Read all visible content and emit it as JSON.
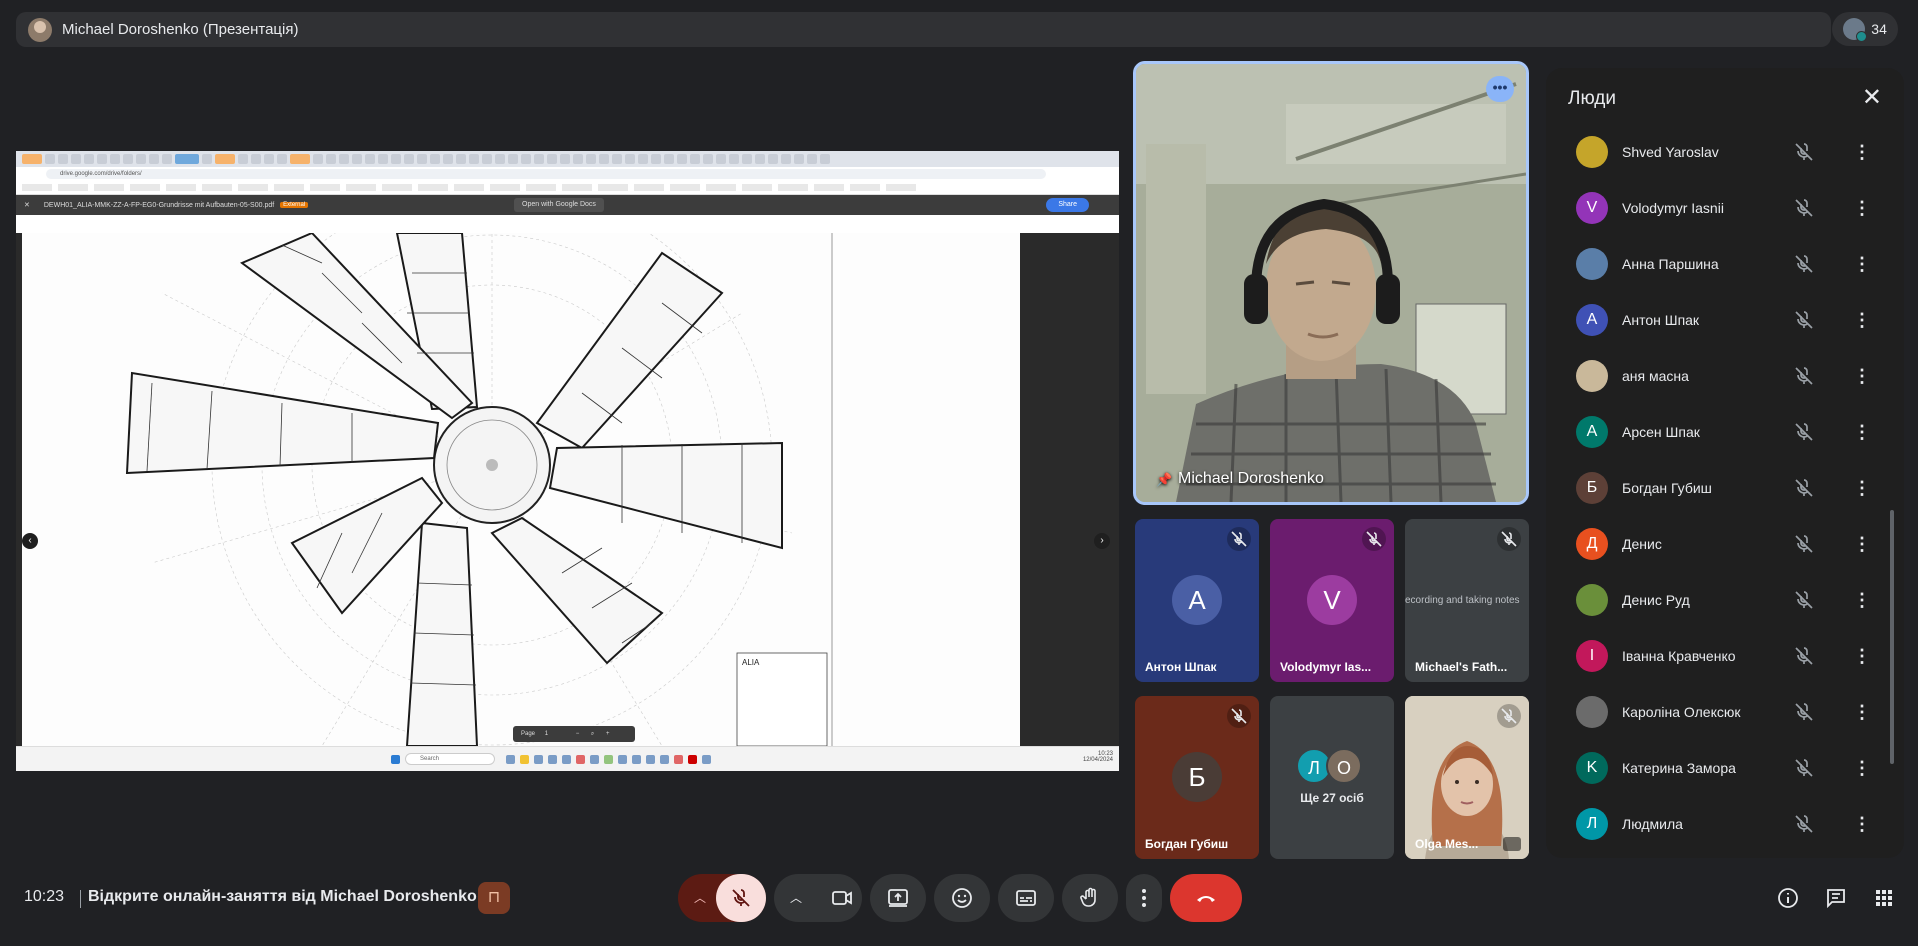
{
  "meeting": {
    "presenter_title": "Michael Doroshenko (Презентація)",
    "participants_count": "34",
    "time": "10:23",
    "title": "Відкрите онлайн-заняття від Michael Doroshenko"
  },
  "presentation": {
    "filename": "DEWH01_ALIA-MMK-ZZ-A-FP-EG0-Grundrisse mit Aufbauten-05-S00.pdf",
    "external_tag": "External",
    "open_with": "Open with Google Docs",
    "share_label": "Share",
    "page_label": "Page",
    "page_number": "1",
    "address": "drive.google.com/drive/folders/",
    "taskbar_search": "Search",
    "taskbar_time": "10:23",
    "taskbar_date": "12/04/2024",
    "title_block": "ALIA"
  },
  "speaker": {
    "name": "Michael Doroshenko",
    "more_label": "•••"
  },
  "tiles": [
    {
      "initial": "A",
      "name": "Антон Шпак"
    },
    {
      "initial": "V",
      "name": "Volodymyr Ias..."
    },
    {
      "name": "Michael's Fath...",
      "caption": "ecording and taking notes"
    },
    {
      "initial": "Б",
      "name": "Богдан Губиш"
    },
    {
      "initials": [
        "Л",
        "О"
      ],
      "name": "Ще 27 осіб"
    },
    {
      "name": "Olga Mes..."
    }
  ],
  "people_panel": {
    "title": "Люди",
    "close_label": "✕",
    "members": [
      {
        "initial": "",
        "name": "Shved Yaroslav",
        "color": "#c5a52a"
      },
      {
        "initial": "V",
        "name": "Volodymyr Iasnii",
        "color": "#9334b8"
      },
      {
        "initial": "",
        "name": "Анна Паршина",
        "color": "#5a7ea8"
      },
      {
        "initial": "A",
        "name": "Антон Шпак",
        "color": "#3f51b5"
      },
      {
        "initial": "",
        "name": "аня масна",
        "color": "#c9b89a"
      },
      {
        "initial": "A",
        "name": "Арсен Шпак",
        "color": "#00796b"
      },
      {
        "initial": "Б",
        "name": "Богдан Губиш",
        "color": "#5d4037"
      },
      {
        "initial": "Д",
        "name": "Денис",
        "color": "#e8501f"
      },
      {
        "initial": "",
        "name": "Денис Руд",
        "color": "#6a8f3a"
      },
      {
        "initial": "I",
        "name": "Іванна Кравченко",
        "color": "#c2185b"
      },
      {
        "initial": "",
        "name": "Кароліна Олексюк",
        "color": "#6b6b6b"
      },
      {
        "initial": "K",
        "name": "Катерина Замора",
        "color": "#00695c"
      },
      {
        "initial": "Л",
        "name": "Людмила",
        "color": "#0097a7"
      }
    ]
  },
  "controls": {
    "mic_muted": true,
    "leave_color": "#dc362e"
  }
}
